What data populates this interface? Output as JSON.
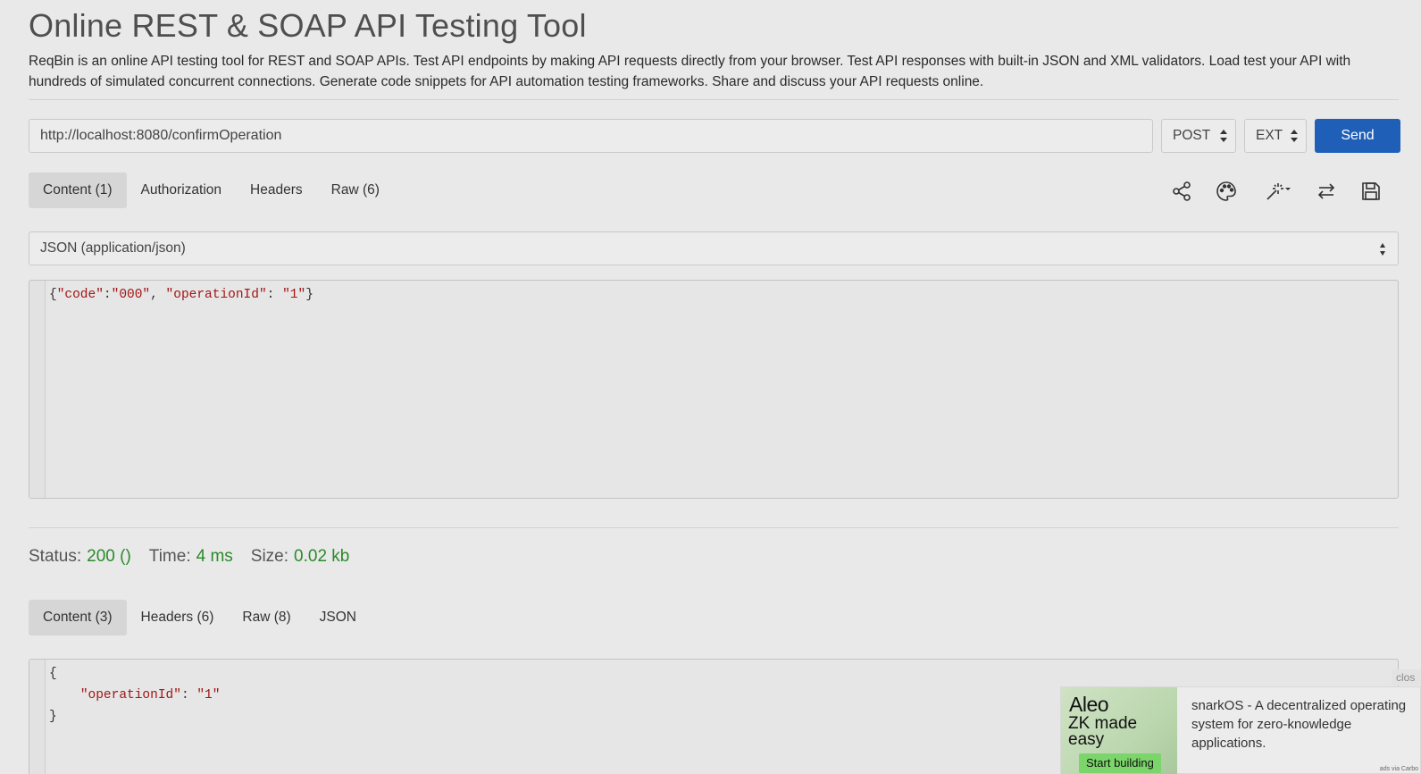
{
  "page": {
    "title": "Online REST & SOAP API Testing Tool",
    "description": "ReqBin is an online API testing tool for REST and SOAP APIs. Test API endpoints by making API requests directly from your browser. Test API responses with built-in JSON and XML validators. Load test your API with hundreds of simulated concurrent connections. Generate code snippets for API automation testing frameworks. Share and discuss your API requests online."
  },
  "request": {
    "url": "http://localhost:8080/confirmOperation",
    "method": "POST",
    "ext": "EXT",
    "send_label": "Send",
    "tabs": [
      {
        "label": "Content (1)",
        "active": true
      },
      {
        "label": "Authorization"
      },
      {
        "label": "Headers"
      },
      {
        "label": "Raw (6)"
      }
    ],
    "toolbar_icons": [
      "share-icon",
      "palette-icon",
      "magic-wand-icon",
      "swap-icon",
      "save-icon"
    ],
    "content_type": "JSON (application/json)",
    "body": {
      "open": "{",
      "key1": "\"code\"",
      "colon1": ":",
      "val1": "\"000\"",
      "sep": ", ",
      "key2": "\"operationId\"",
      "colon2": ": ",
      "val2": "\"1\"",
      "close": "}"
    }
  },
  "response": {
    "status_label": "Status:",
    "status_value": "200 ()",
    "time_label": "Time:",
    "time_value": "4 ms",
    "size_label": "Size:",
    "size_value": "0.02 kb",
    "tabs": [
      {
        "label": "Content (3)",
        "active": true
      },
      {
        "label": "Headers (6)"
      },
      {
        "label": "Raw (8)"
      },
      {
        "label": "JSON"
      }
    ],
    "body": {
      "line1": "{",
      "indent": "    ",
      "key": "\"operationId\"",
      "colon": ": ",
      "value": "\"1\"",
      "line3": "}"
    }
  },
  "ad": {
    "close_label": "clos",
    "logo": "Aleo",
    "tagline": "ZK made easy",
    "cta": "Start building",
    "text": "snarkOS - A decentralized operating system for zero-knowledge applications.",
    "via": "ads via Carbo"
  },
  "colors": {
    "accent": "#1f5fb8",
    "status_green": "#2a8a2a",
    "json_string": "#a31515"
  }
}
